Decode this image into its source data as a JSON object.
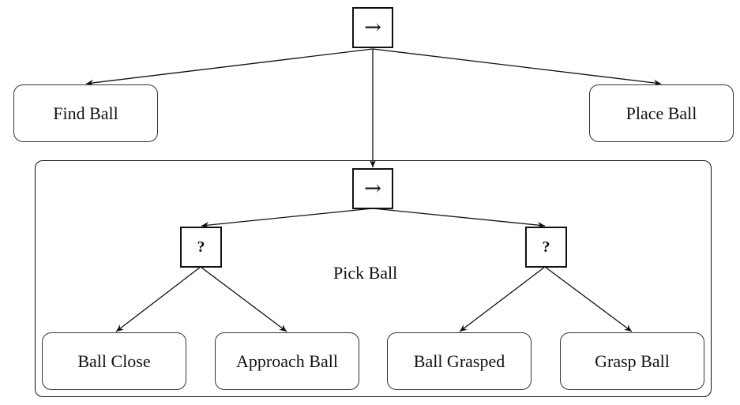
{
  "diagram": {
    "type": "behavior-tree",
    "root": {
      "kind": "sequence",
      "glyph": "→"
    },
    "top_children": {
      "find": {
        "label": "Find Ball"
      },
      "place": {
        "label": "Place Ball"
      }
    },
    "subtree": {
      "label": "Pick Ball",
      "sequence": {
        "kind": "sequence",
        "glyph": "→"
      },
      "fallback_left": {
        "kind": "fallback",
        "glyph": "?",
        "children": [
          {
            "label": "Ball Close"
          },
          {
            "label": "Approach Ball"
          }
        ]
      },
      "fallback_right": {
        "kind": "fallback",
        "glyph": "?",
        "children": [
          {
            "label": "Ball Grasped"
          },
          {
            "label": "Grasp Ball"
          }
        ]
      }
    },
    "colors": {
      "stroke": "#111111",
      "background": "#ffffff"
    }
  }
}
